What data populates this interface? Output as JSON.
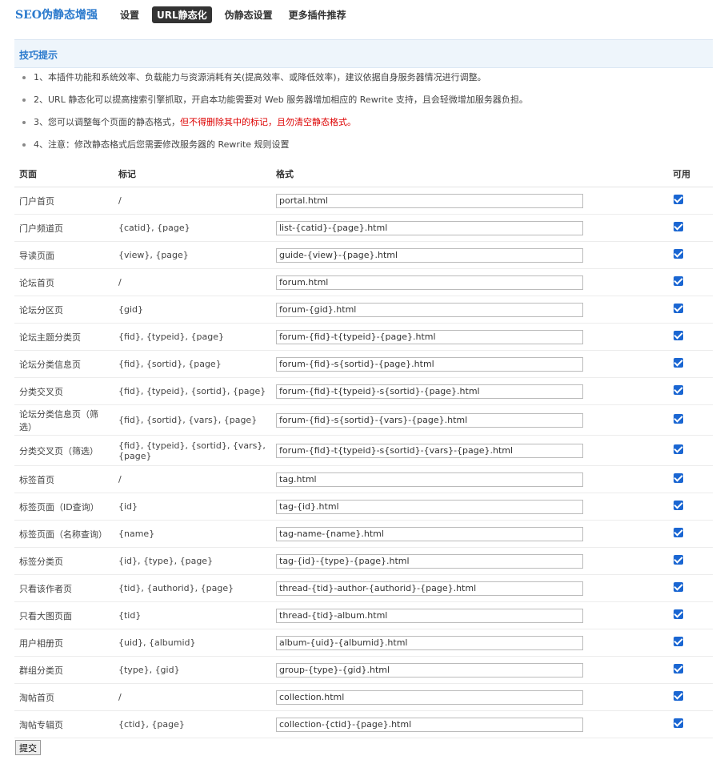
{
  "brand": "SEO伪静态增强",
  "nav": [
    {
      "label": "设置",
      "active": false
    },
    {
      "label": "URL静态化",
      "active": true
    },
    {
      "label": "伪静态设置",
      "active": false
    },
    {
      "label": "更多插件推荐",
      "active": false
    }
  ],
  "tips": {
    "title": "技巧提示",
    "items": [
      {
        "text": "1、本插件功能和系统效率、负载能力与资源消耗有关(提高效率、或降低效率)，建议依据自身服务器情况进行调整。"
      },
      {
        "text": "2、URL 静态化可以提高搜索引擎抓取，开启本功能需要对 Web 服务器增加相应的 Rewrite 支持，且会轻微增加服务器负担。"
      },
      {
        "text": "3、您可以调整每个页面的静态格式，",
        "red": "但不得删除其中的标记，且勿清空静态格式。"
      },
      {
        "text": "4、注意：修改静态格式后您需要修改服务器的 Rewrite 规则设置"
      }
    ]
  },
  "table": {
    "headers": {
      "page": "页面",
      "mark": "标记",
      "format": "格式",
      "available": "可用"
    },
    "rows": [
      {
        "page": "门户首页",
        "mark": "/",
        "format": "portal.html",
        "enabled": true
      },
      {
        "page": "门户频道页",
        "mark": "{catid}, {page}",
        "format": "list-{catid}-{page}.html",
        "enabled": true
      },
      {
        "page": "导读页面",
        "mark": "{view}, {page}",
        "format": "guide-{view}-{page}.html",
        "enabled": true
      },
      {
        "page": "论坛首页",
        "mark": "/",
        "format": "forum.html",
        "enabled": true
      },
      {
        "page": "论坛分区页",
        "mark": "{gid}",
        "format": "forum-{gid}.html",
        "enabled": true
      },
      {
        "page": "论坛主题分类页",
        "mark": "{fid}, {typeid}, {page}",
        "format": "forum-{fid}-t{typeid}-{page}.html",
        "enabled": true
      },
      {
        "page": "论坛分类信息页",
        "mark": "{fid}, {sortid}, {page}",
        "format": "forum-{fid}-s{sortid}-{page}.html",
        "enabled": true
      },
      {
        "page": "分类交叉页",
        "mark": "{fid}, {typeid}, {sortid}, {page}",
        "format": "forum-{fid}-t{typeid}-s{sortid}-{page}.html",
        "enabled": true
      },
      {
        "page": "论坛分类信息页（筛选）",
        "mark": "{fid}, {sortid}, {vars}, {page}",
        "format": "forum-{fid}-s{sortid}-{vars}-{page}.html",
        "enabled": true
      },
      {
        "page": "分类交叉页（筛选）",
        "mark": "{fid}, {typeid}, {sortid}, {vars}, {page}",
        "format": "forum-{fid}-t{typeid}-s{sortid}-{vars}-{page}.html",
        "enabled": true
      },
      {
        "page": "标签首页",
        "mark": "/",
        "format": "tag.html",
        "enabled": true
      },
      {
        "page": "标签页面（ID查询）",
        "mark": "{id}",
        "format": "tag-{id}.html",
        "enabled": true
      },
      {
        "page": "标签页面（名称查询）",
        "mark": "{name}",
        "format": "tag-name-{name}.html",
        "enabled": true
      },
      {
        "page": "标签分类页",
        "mark": "{id}, {type}, {page}",
        "format": "tag-{id}-{type}-{page}.html",
        "enabled": true
      },
      {
        "page": "只看该作者页",
        "mark": "{tid}, {authorid}, {page}",
        "format": "thread-{tid}-author-{authorid}-{page}.html",
        "enabled": true
      },
      {
        "page": "只看大图页面",
        "mark": "{tid}",
        "format": "thread-{tid}-album.html",
        "enabled": true
      },
      {
        "page": "用户相册页",
        "mark": "{uid}, {albumid}",
        "format": "album-{uid}-{albumid}.html",
        "enabled": true
      },
      {
        "page": "群组分类页",
        "mark": "{type}, {gid}",
        "format": "group-{type}-{gid}.html",
        "enabled": true
      },
      {
        "page": "淘帖首页",
        "mark": "/",
        "format": "collection.html",
        "enabled": true
      },
      {
        "page": "淘帖专辑页",
        "mark": "{ctid}, {page}",
        "format": "collection-{ctid}-{page}.html",
        "enabled": true
      }
    ]
  },
  "submit_label": "提交",
  "colors": {
    "brand": "#2b7acd",
    "checkbox": "#1a66d2",
    "warning": "#dd0000"
  }
}
